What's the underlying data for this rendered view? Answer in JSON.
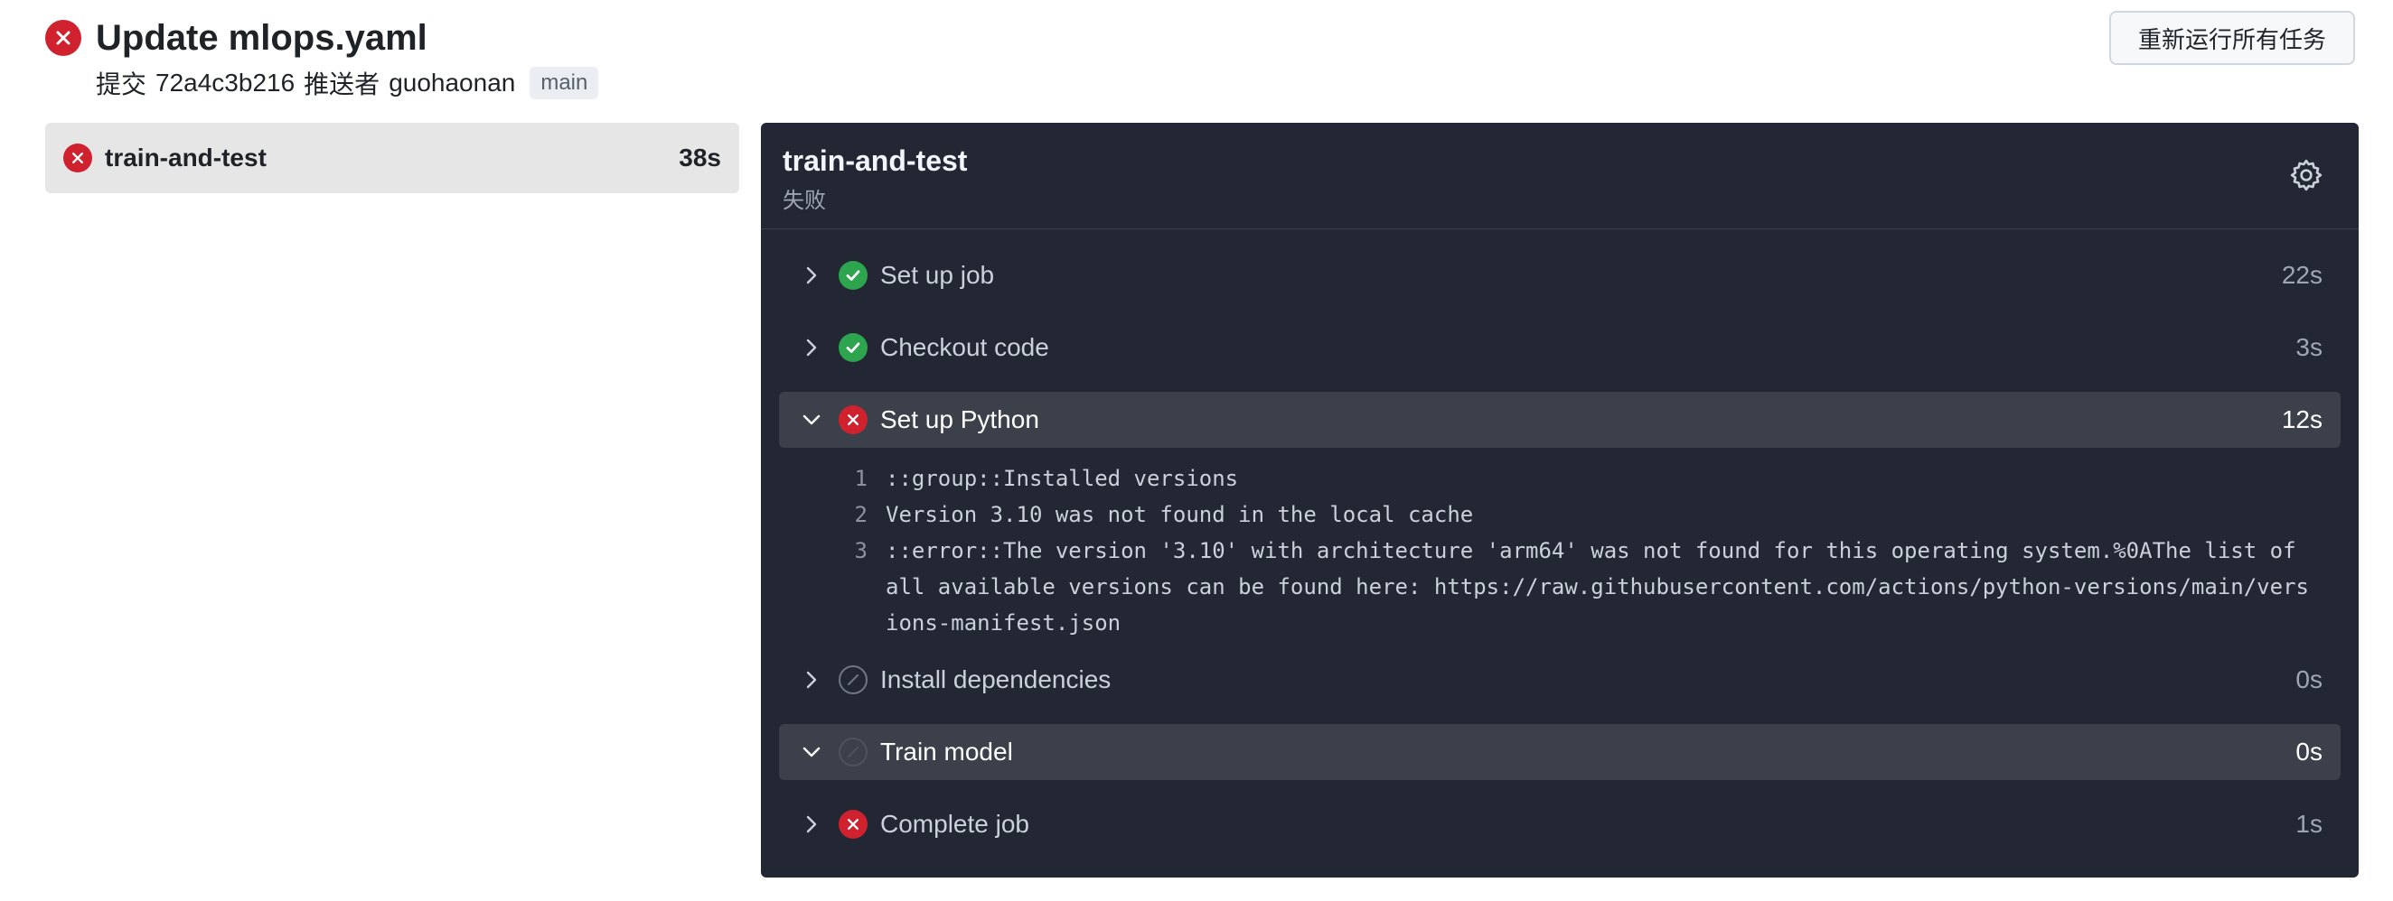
{
  "header": {
    "title": "Update mlops.yaml",
    "commit_prefix": "提交",
    "commit_hash": "72a4c3b216",
    "pusher_prefix": "推送者",
    "pusher": "guohaonan",
    "branch": "main",
    "rerun_label": "重新运行所有任务"
  },
  "jobs": [
    {
      "name": "train-and-test",
      "duration": "38s",
      "status": "failure"
    }
  ],
  "panel": {
    "title": "train-and-test",
    "status": "失败",
    "steps": [
      {
        "name": "Set up job",
        "time": "22s",
        "status": "success",
        "expanded": false
      },
      {
        "name": "Checkout code",
        "time": "3s",
        "status": "success",
        "expanded": false
      },
      {
        "name": "Set up Python",
        "time": "12s",
        "status": "failure",
        "expanded": true
      },
      {
        "name": "Install dependencies",
        "time": "0s",
        "status": "skipped",
        "expanded": false
      },
      {
        "name": "Train model",
        "time": "0s",
        "status": "skipped",
        "expanded": true
      },
      {
        "name": "Complete job",
        "time": "1s",
        "status": "failure",
        "expanded": false
      }
    ],
    "log": [
      {
        "num": "1",
        "text": "::group::Installed versions"
      },
      {
        "num": "2",
        "text": "Version 3.10 was not found in the local cache"
      },
      {
        "num": "3",
        "text": "::error::The version '3.10' with architecture 'arm64' was not found for this operating system.%0AThe list of all available versions can be found here: https://raw.githubusercontent.com/actions/python-versions/main/versions-manifest.json"
      }
    ]
  },
  "colors": {
    "failure": "#cf222e",
    "success": "#2da44e",
    "panel_bg": "#232733"
  }
}
